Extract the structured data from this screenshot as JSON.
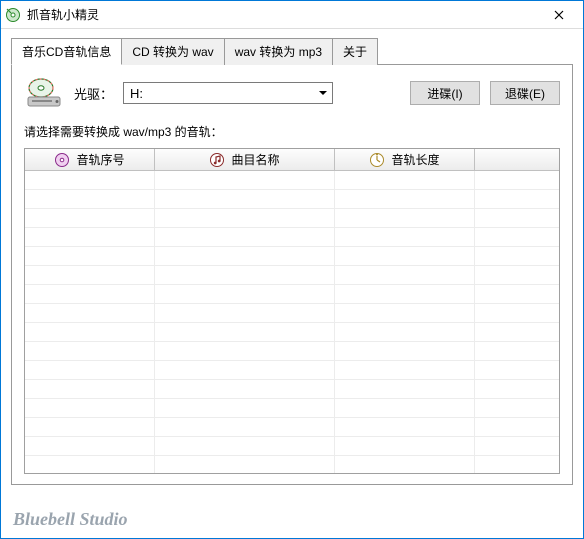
{
  "window": {
    "title": "抓音轨小精灵"
  },
  "tabs": {
    "items": [
      {
        "label": "音乐CD音轨信息",
        "active": true
      },
      {
        "label": "CD 转换为 wav",
        "active": false
      },
      {
        "label": "wav 转换为 mp3",
        "active": false
      },
      {
        "label": "关于",
        "active": false
      }
    ]
  },
  "drive": {
    "label": "光驱：",
    "selected": "H:",
    "options": [
      "H:"
    ]
  },
  "buttons": {
    "load": "进碟(I)",
    "eject": "退碟(E)"
  },
  "instruction": "请选择需要转换成 wav/mp3 的音轨：",
  "grid": {
    "columns": [
      {
        "label": "音轨序号",
        "icon": "cd-disc-icon"
      },
      {
        "label": "曲目名称",
        "icon": "music-note-icon"
      },
      {
        "label": "音轨长度",
        "icon": "clock-icon"
      }
    ],
    "rows": []
  },
  "footer": "Bluebell Studio"
}
